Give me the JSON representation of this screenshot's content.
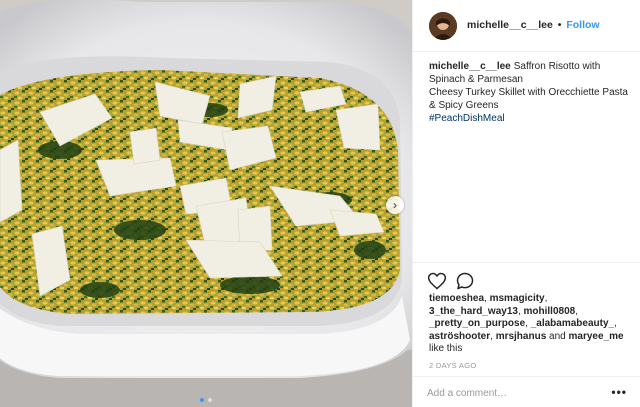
{
  "post": {
    "image_alt": "food photo",
    "carousel": {
      "next_icon": "chevron-right-icon",
      "dots": 2,
      "active_dot": 0
    }
  },
  "header": {
    "username": "michelle__c__lee",
    "separator": "•",
    "follow_label": "Follow"
  },
  "caption": {
    "username": "michelle__c__lee",
    "lines": [
      "Saffron Risotto with",
      "Spinach & Parmesan",
      "Cheesy Turkey Skillet with Orecchiette Pasta",
      "& Spicy Greens"
    ],
    "hashtag": "#PeachDishMeal"
  },
  "actions": {
    "like_icon": "heart-outline-icon",
    "comment_icon": "speech-bubble-icon"
  },
  "likes": {
    "users": [
      "tiemoeshea",
      "msmagicity",
      "3_the_hard_way13",
      "mohill0808",
      "_pretty_on_purpose",
      "_alabamabeauty_",
      "aströshooter",
      "mrsjhanus"
    ],
    "sep": ", ",
    "and": " and ",
    "last_user": "maryee_me",
    "suffix": "like this"
  },
  "timestamp": "2 DAYS AGO",
  "comment": {
    "placeholder": "Add a comment…",
    "more_label": "•••"
  },
  "colors": {
    "link_blue": "#3897f0",
    "hashtag_blue": "#003569",
    "text": "#262626",
    "muted": "#999999"
  }
}
